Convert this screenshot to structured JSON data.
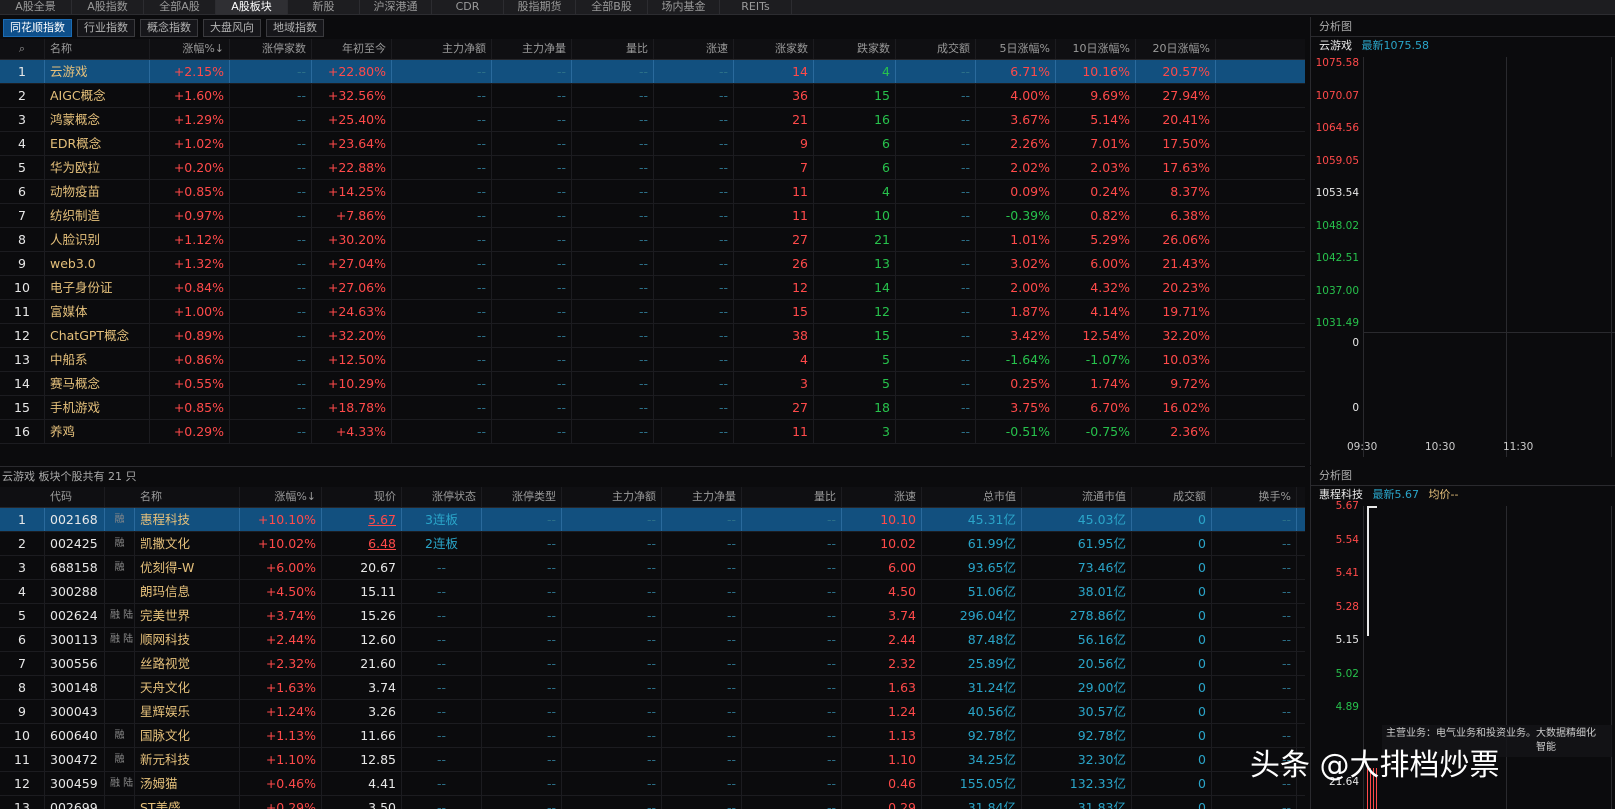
{
  "top_tabs": [
    {
      "label": "A股全景",
      "w": 72
    },
    {
      "label": "A股指数",
      "w": 72
    },
    {
      "label": "全部A股",
      "w": 72
    },
    {
      "label": "A股板块",
      "w": 72,
      "active": true
    },
    {
      "label": "新股",
      "w": 72
    },
    {
      "label": "沪深港通",
      "w": 72
    },
    {
      "label": "CDR",
      "w": 72
    },
    {
      "label": "股指期货",
      "w": 72
    },
    {
      "label": "全部B股",
      "w": 72
    },
    {
      "label": "场内基金",
      "w": 72
    },
    {
      "label": "REITs",
      "w": 72
    }
  ],
  "sub_tabs": [
    {
      "label": "同花顺指数",
      "active": true
    },
    {
      "label": "行业指数"
    },
    {
      "label": "概念指数"
    },
    {
      "label": "大盘风向"
    },
    {
      "label": "地域指数"
    }
  ],
  "sector_table": {
    "headers": [
      "名称",
      "涨幅%↓",
      "涨停家数",
      "年初至今",
      "主力净额",
      "主力净量",
      "量比",
      "涨速",
      "涨家数",
      "跌家数",
      "成交额",
      "5日涨幅%",
      "10日涨幅%",
      "20日涨幅%"
    ],
    "rows": [
      {
        "n": "1",
        "name": "云游戏",
        "chg": "+2.15%",
        "lim": "--",
        "ytd": "+22.80%",
        "nf": "--",
        "nv": "--",
        "vr": "--",
        "spd": "--",
        "up": "14",
        "dn": "4",
        "amt": "--",
        "d5": "6.71%",
        "d10": "10.16%",
        "d20": "20.57%"
      },
      {
        "n": "2",
        "name": "AIGC概念",
        "chg": "+1.60%",
        "lim": "--",
        "ytd": "+32.56%",
        "nf": "--",
        "nv": "--",
        "vr": "--",
        "spd": "--",
        "up": "36",
        "dn": "15",
        "amt": "--",
        "d5": "4.00%",
        "d10": "9.69%",
        "d20": "27.94%"
      },
      {
        "n": "3",
        "name": "鸿蒙概念",
        "chg": "+1.29%",
        "lim": "--",
        "ytd": "+25.40%",
        "nf": "--",
        "nv": "--",
        "vr": "--",
        "spd": "--",
        "up": "21",
        "dn": "16",
        "amt": "--",
        "d5": "3.67%",
        "d10": "5.14%",
        "d20": "20.41%"
      },
      {
        "n": "4",
        "name": "EDR概念",
        "chg": "+1.02%",
        "lim": "--",
        "ytd": "+23.64%",
        "nf": "--",
        "nv": "--",
        "vr": "--",
        "spd": "--",
        "up": "9",
        "dn": "6",
        "amt": "--",
        "d5": "2.26%",
        "d10": "7.01%",
        "d20": "17.50%"
      },
      {
        "n": "5",
        "name": "华为欧拉",
        "chg": "+0.20%",
        "lim": "--",
        "ytd": "+22.88%",
        "nf": "--",
        "nv": "--",
        "vr": "--",
        "spd": "--",
        "up": "7",
        "dn": "6",
        "amt": "--",
        "d5": "2.02%",
        "d10": "2.03%",
        "d20": "17.63%"
      },
      {
        "n": "6",
        "name": "动物疫苗",
        "chg": "+0.85%",
        "lim": "--",
        "ytd": "+14.25%",
        "nf": "--",
        "nv": "--",
        "vr": "--",
        "spd": "--",
        "up": "11",
        "dn": "4",
        "amt": "--",
        "d5": "0.09%",
        "d10": "0.24%",
        "d20": "8.37%"
      },
      {
        "n": "7",
        "name": "纺织制造",
        "chg": "+0.97%",
        "lim": "--",
        "ytd": "+7.86%",
        "nf": "--",
        "nv": "--",
        "vr": "--",
        "spd": "--",
        "up": "11",
        "dn": "10",
        "amt": "--",
        "d5": "-0.39%",
        "d10": "0.82%",
        "d20": "6.38%"
      },
      {
        "n": "8",
        "name": "人脸识别",
        "chg": "+1.12%",
        "lim": "--",
        "ytd": "+30.20%",
        "nf": "--",
        "nv": "--",
        "vr": "--",
        "spd": "--",
        "up": "27",
        "dn": "21",
        "amt": "--",
        "d5": "1.01%",
        "d10": "5.29%",
        "d20": "26.06%"
      },
      {
        "n": "9",
        "name": "web3.0",
        "chg": "+1.32%",
        "lim": "--",
        "ytd": "+27.04%",
        "nf": "--",
        "nv": "--",
        "vr": "--",
        "spd": "--",
        "up": "26",
        "dn": "13",
        "amt": "--",
        "d5": "3.02%",
        "d10": "6.00%",
        "d20": "21.43%"
      },
      {
        "n": "10",
        "name": "电子身份证",
        "chg": "+0.84%",
        "lim": "--",
        "ytd": "+27.06%",
        "nf": "--",
        "nv": "--",
        "vr": "--",
        "spd": "--",
        "up": "12",
        "dn": "14",
        "amt": "--",
        "d5": "2.00%",
        "d10": "4.32%",
        "d20": "20.23%"
      },
      {
        "n": "11",
        "name": "富媒体",
        "chg": "+1.00%",
        "lim": "--",
        "ytd": "+24.63%",
        "nf": "--",
        "nv": "--",
        "vr": "--",
        "spd": "--",
        "up": "15",
        "dn": "12",
        "amt": "--",
        "d5": "1.87%",
        "d10": "4.14%",
        "d20": "19.71%"
      },
      {
        "n": "12",
        "name": "ChatGPT概念",
        "chg": "+0.89%",
        "lim": "--",
        "ytd": "+32.20%",
        "nf": "--",
        "nv": "--",
        "vr": "--",
        "spd": "--",
        "up": "38",
        "dn": "15",
        "amt": "--",
        "d5": "3.42%",
        "d10": "12.54%",
        "d20": "32.20%"
      },
      {
        "n": "13",
        "name": "中船系",
        "chg": "+0.86%",
        "lim": "--",
        "ytd": "+12.50%",
        "nf": "--",
        "nv": "--",
        "vr": "--",
        "spd": "--",
        "up": "4",
        "dn": "5",
        "amt": "--",
        "d5": "-1.64%",
        "d10": "-1.07%",
        "d20": "10.03%"
      },
      {
        "n": "14",
        "name": "赛马概念",
        "chg": "+0.55%",
        "lim": "--",
        "ytd": "+10.29%",
        "nf": "--",
        "nv": "--",
        "vr": "--",
        "spd": "--",
        "up": "3",
        "dn": "5",
        "amt": "--",
        "d5": "0.25%",
        "d10": "1.74%",
        "d20": "9.72%"
      },
      {
        "n": "15",
        "name": "手机游戏",
        "chg": "+0.85%",
        "lim": "--",
        "ytd": "+18.78%",
        "nf": "--",
        "nv": "--",
        "vr": "--",
        "spd": "--",
        "up": "27",
        "dn": "18",
        "amt": "--",
        "d5": "3.75%",
        "d10": "6.70%",
        "d20": "16.02%"
      },
      {
        "n": "16",
        "name": "养鸡",
        "chg": "+0.29%",
        "lim": "--",
        "ytd": "+4.33%",
        "nf": "--",
        "nv": "--",
        "vr": "--",
        "spd": "--",
        "up": "11",
        "dn": "3",
        "amt": "--",
        "d5": "-0.51%",
        "d10": "-0.75%",
        "d20": "2.36%"
      }
    ]
  },
  "stocks_panel_title": "云游戏  板块个股共有 21 只",
  "stock_table": {
    "headers": [
      "代码",
      "名称",
      "涨幅%↓",
      "现价",
      "涨停状态",
      "涨停类型",
      "主力净额",
      "主力净量",
      "量比",
      "涨速",
      "总市值",
      "流通市值",
      "成交额",
      "换手%"
    ],
    "rows": [
      {
        "n": "1",
        "code": "002168",
        "tag": "融",
        "name": "惠程科技",
        "chg": "+10.10%",
        "price": "5.67",
        "st": "3连板",
        "typ": "--",
        "nf": "--",
        "nv": "--",
        "vr": "--",
        "spd": "10.10",
        "cap": "45.31亿",
        "flt": "45.03亿",
        "amt": "0",
        "tr": "--"
      },
      {
        "n": "2",
        "code": "002425",
        "tag": "融",
        "name": "凯撒文化",
        "chg": "+10.02%",
        "price": "6.48",
        "st": "2连板",
        "typ": "--",
        "nf": "--",
        "nv": "--",
        "vr": "--",
        "spd": "10.02",
        "cap": "61.99亿",
        "flt": "61.95亿",
        "amt": "0",
        "tr": "--"
      },
      {
        "n": "3",
        "code": "688158",
        "tag": "融",
        "name": "优刻得-W",
        "chg": "+6.00%",
        "price": "20.67",
        "st": "--",
        "typ": "--",
        "nf": "--",
        "nv": "--",
        "vr": "--",
        "spd": "6.00",
        "cap": "93.65亿",
        "flt": "73.46亿",
        "amt": "0",
        "tr": "--"
      },
      {
        "n": "4",
        "code": "300288",
        "tag": "",
        "name": "朗玛信息",
        "chg": "+4.50%",
        "price": "15.11",
        "st": "--",
        "typ": "--",
        "nf": "--",
        "nv": "--",
        "vr": "--",
        "spd": "4.50",
        "cap": "51.06亿",
        "flt": "38.01亿",
        "amt": "0",
        "tr": "--"
      },
      {
        "n": "5",
        "code": "002624",
        "tag": "融 陆",
        "name": "完美世界",
        "chg": "+3.74%",
        "price": "15.26",
        "st": "--",
        "typ": "--",
        "nf": "--",
        "nv": "--",
        "vr": "--",
        "spd": "3.74",
        "cap": "296.04亿",
        "flt": "278.86亿",
        "amt": "0",
        "tr": "--"
      },
      {
        "n": "6",
        "code": "300113",
        "tag": "融 陆",
        "name": "顺网科技",
        "chg": "+2.44%",
        "price": "12.60",
        "st": "--",
        "typ": "--",
        "nf": "--",
        "nv": "--",
        "vr": "--",
        "spd": "2.44",
        "cap": "87.48亿",
        "flt": "56.16亿",
        "amt": "0",
        "tr": "--"
      },
      {
        "n": "7",
        "code": "300556",
        "tag": "",
        "name": "丝路视觉",
        "chg": "+2.32%",
        "price": "21.60",
        "st": "--",
        "typ": "--",
        "nf": "--",
        "nv": "--",
        "vr": "--",
        "spd": "2.32",
        "cap": "25.89亿",
        "flt": "20.56亿",
        "amt": "0",
        "tr": "--"
      },
      {
        "n": "8",
        "code": "300148",
        "tag": "",
        "name": "天舟文化",
        "chg": "+1.63%",
        "price": "3.74",
        "st": "--",
        "typ": "--",
        "nf": "--",
        "nv": "--",
        "vr": "--",
        "spd": "1.63",
        "cap": "31.24亿",
        "flt": "29.00亿",
        "amt": "0",
        "tr": "--"
      },
      {
        "n": "9",
        "code": "300043",
        "tag": "",
        "name": "星辉娱乐",
        "chg": "+1.24%",
        "price": "3.26",
        "st": "--",
        "typ": "--",
        "nf": "--",
        "nv": "--",
        "vr": "--",
        "spd": "1.24",
        "cap": "40.56亿",
        "flt": "30.57亿",
        "amt": "0",
        "tr": "--"
      },
      {
        "n": "10",
        "code": "600640",
        "tag": "融",
        "name": "国脉文化",
        "chg": "+1.13%",
        "price": "11.66",
        "st": "--",
        "typ": "--",
        "nf": "--",
        "nv": "--",
        "vr": "--",
        "spd": "1.13",
        "cap": "92.78亿",
        "flt": "92.78亿",
        "amt": "0",
        "tr": "--"
      },
      {
        "n": "11",
        "code": "300472",
        "tag": "融",
        "name": "新元科技",
        "chg": "+1.10%",
        "price": "12.85",
        "st": "--",
        "typ": "--",
        "nf": "--",
        "nv": "--",
        "vr": "--",
        "spd": "1.10",
        "cap": "34.25亿",
        "flt": "32.30亿",
        "amt": "0",
        "tr": "--"
      },
      {
        "n": "12",
        "code": "300459",
        "tag": "融 陆",
        "name": "汤姆猫",
        "chg": "+0.46%",
        "price": "4.41",
        "st": "--",
        "typ": "--",
        "nf": "--",
        "nv": "--",
        "vr": "--",
        "spd": "0.46",
        "cap": "155.05亿",
        "flt": "132.33亿",
        "amt": "0",
        "tr": "--"
      },
      {
        "n": "13",
        "code": "002699",
        "tag": "",
        "name": "ST美盛",
        "chg": "+0.29%",
        "price": "3.50",
        "st": "--",
        "typ": "--",
        "nf": "--",
        "nv": "--",
        "vr": "--",
        "spd": "0.29",
        "cap": "31.84亿",
        "flt": "31.83亿",
        "amt": "0",
        "tr": "--"
      }
    ]
  },
  "side_top": {
    "title": "分析图",
    "name": "云游戏",
    "latest": "最新1075.58",
    "y_ticks": [
      "1075.58",
      "1070.07",
      "1064.56",
      "1059.05",
      "1053.54",
      "1048.02",
      "1042.51",
      "1037.00",
      "1031.49"
    ],
    "sub_ticks": [
      "0",
      "0"
    ],
    "x_ticks": [
      "09:30",
      "10:30",
      "11:30"
    ]
  },
  "side_bottom": {
    "title": "分析图",
    "name": "惠程科技",
    "latest": "最新5.67",
    "avg": "均价--",
    "y_ticks": [
      "5.67",
      "5.54",
      "5.41",
      "5.28",
      "5.15",
      "5.02",
      "4.89"
    ],
    "extra": "21.64",
    "biz": "主营业务：电气业务和投资业务。大数据精细化",
    "biz2": "智能"
  },
  "watermark": "头条 @大排档炒票",
  "colors": {
    "up": "#ff4a4a",
    "down": "#27c24c",
    "name": "#e5c07b",
    "accent": "#2aa5c9",
    "select": "#12507f"
  }
}
